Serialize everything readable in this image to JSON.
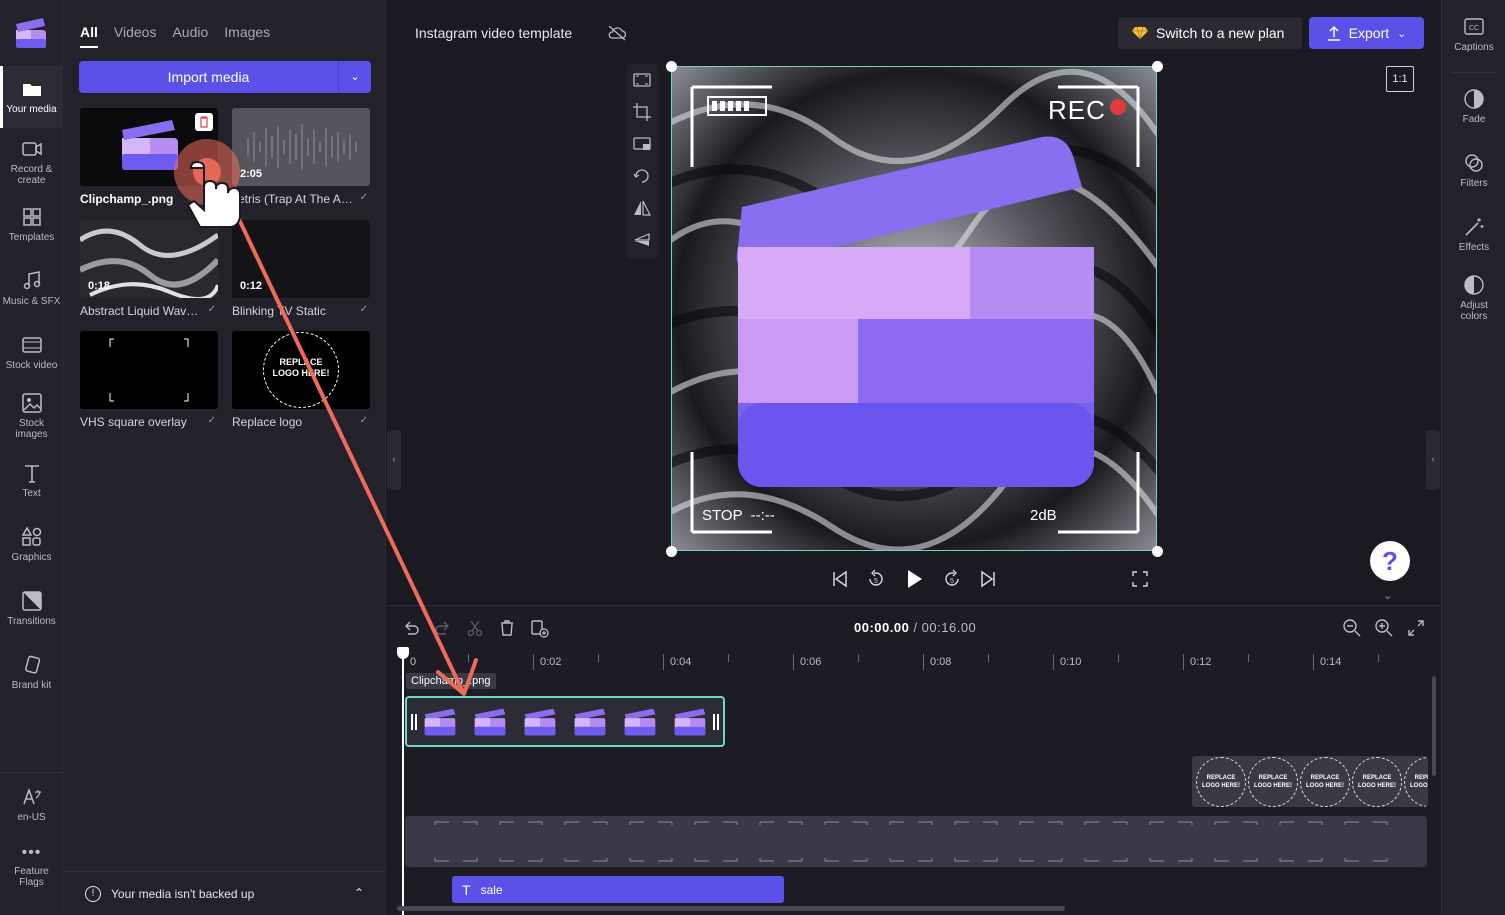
{
  "nav": {
    "items": [
      {
        "id": "your-media",
        "label": "Your media"
      },
      {
        "id": "record-create",
        "label": "Record &\ncreate"
      },
      {
        "id": "templates",
        "label": "Templates"
      },
      {
        "id": "music-sfx",
        "label": "Music & SFX"
      },
      {
        "id": "stock-video",
        "label": "Stock video"
      },
      {
        "id": "stock-images",
        "label": "Stock\nimages"
      },
      {
        "id": "text",
        "label": "Text"
      },
      {
        "id": "graphics",
        "label": "Graphics"
      },
      {
        "id": "transitions",
        "label": "Transitions"
      },
      {
        "id": "brand-kit",
        "label": "Brand kit"
      }
    ],
    "language": "en-US",
    "feature_flags": "Feature\nFlags"
  },
  "media": {
    "tabs": [
      "All",
      "Videos",
      "Audio",
      "Images"
    ],
    "active_tab": "All",
    "import_label": "Import media",
    "items": [
      {
        "label": "Clipchamp_.png",
        "duration": ""
      },
      {
        "label": "Tetris (Trap At The Arc...",
        "duration": "2:05"
      },
      {
        "label": "Abstract Liquid Wavy ...",
        "duration": "0:18"
      },
      {
        "label": "Blinking TV Static",
        "duration": "0:12"
      },
      {
        "label": "VHS square overlay",
        "duration": ""
      },
      {
        "label": "Replace logo",
        "duration": "",
        "thumb_text": "REPLACE LOGO HERE!"
      }
    ],
    "backup_text": "Your media isn't backed up"
  },
  "topbar": {
    "project_title": "Instagram video template",
    "plan_label": "Switch to a new plan",
    "export_label": "Export"
  },
  "right_panel": {
    "items": [
      {
        "id": "captions",
        "label": "Captions"
      },
      {
        "id": "fade",
        "label": "Fade"
      },
      {
        "id": "filters",
        "label": "Filters"
      },
      {
        "id": "effects",
        "label": "Effects"
      },
      {
        "id": "adjust-colors",
        "label": "Adjust\ncolors"
      }
    ]
  },
  "preview": {
    "aspect_ratio": "1:1",
    "overlay_rec": "REC",
    "overlay_stop": "STOP  --:--",
    "overlay_db": "2dB",
    "help": "?"
  },
  "timeline": {
    "current_time": "00:00.00",
    "total_time": "/ 00:16.00",
    "ruler": [
      "0",
      "0:02",
      "0:04",
      "0:06",
      "0:08",
      "0:10",
      "0:12",
      "0:14"
    ],
    "clip_name": "Clipchamp_.png",
    "logo_cell_text": "REPLACE\nLOGO HERE!",
    "text_clip": "sale"
  },
  "colors": {
    "accent": "#5b50e8",
    "selection": "#6fd6c2",
    "drag_arrow": "#ee6b5b"
  }
}
